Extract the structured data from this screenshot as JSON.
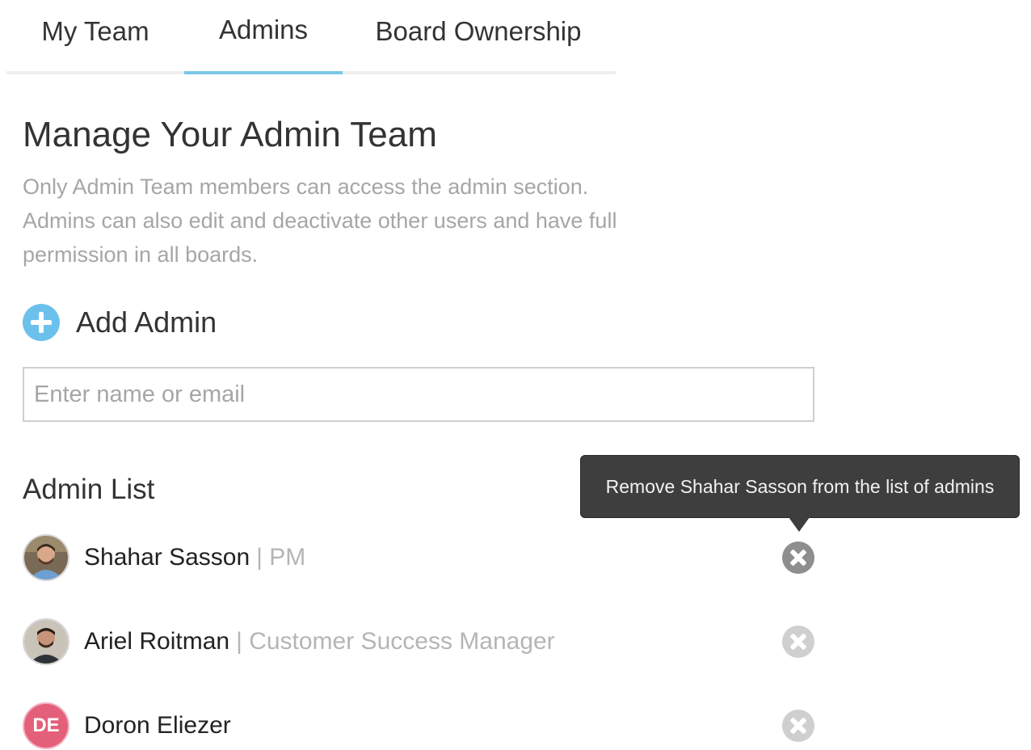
{
  "tabs": [
    {
      "label": "My Team",
      "active": false
    },
    {
      "label": "Admins",
      "active": true
    },
    {
      "label": "Board Ownership",
      "active": false
    }
  ],
  "header": {
    "title": "Manage Your Admin Team",
    "description": "Only Admin Team members can access the admin section. Admins can also edit and deactivate other users and have full permission in all boards."
  },
  "add_admin": {
    "label": "Add Admin",
    "icon": "plus-circle-icon",
    "input_placeholder": "Enter name or email",
    "input_value": ""
  },
  "admin_list": {
    "title": "Admin List",
    "items": [
      {
        "name": "Shahar Sasson",
        "role": "| PM",
        "avatar": "photo"
      },
      {
        "name": "Ariel Roitman",
        "role": "| Customer Success Manager",
        "avatar": "photo"
      },
      {
        "name": "Doron Eliezer",
        "role": "",
        "avatar": "initials",
        "initials": "DE"
      }
    ]
  },
  "tooltip": {
    "text": "Remove Shahar Sasson from the list of admins"
  },
  "colors": {
    "accent": "#7ac8ea",
    "add_icon": "#6cc1ec",
    "initials_avatar": "#e45f7a",
    "tooltip_bg": "#3e3e3e"
  }
}
